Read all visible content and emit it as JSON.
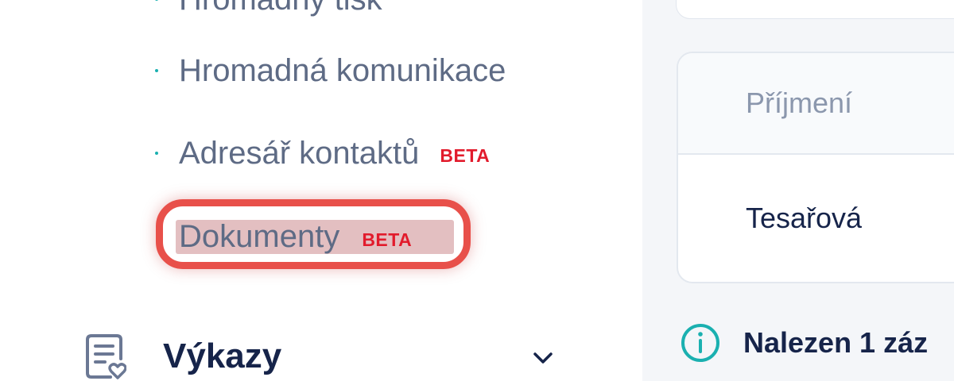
{
  "sidebar": {
    "cut_item_label": "Hromadný tisk",
    "items": [
      {
        "label": "Hromadná komunikace"
      },
      {
        "label": "Adresář kontaktů",
        "badge": "BETA"
      },
      {
        "label": "Dokumenty",
        "badge": "BETA",
        "highlighted": true
      }
    ],
    "section": {
      "label": "Výkazy",
      "icon": "report-heart-icon",
      "expand_icon": "chevron-down-icon"
    }
  },
  "main": {
    "table": {
      "header": "Příjmení",
      "rows": [
        "Tesařová"
      ]
    },
    "status": {
      "icon": "info-icon",
      "text": "Nalezen 1 záz"
    }
  },
  "colors": {
    "accent_teal": "#1ab0b0",
    "badge_red": "#e21b2c",
    "highlight_ring": "#e8504a",
    "text_dark": "#16244a",
    "text_muted": "#5e6b85"
  }
}
